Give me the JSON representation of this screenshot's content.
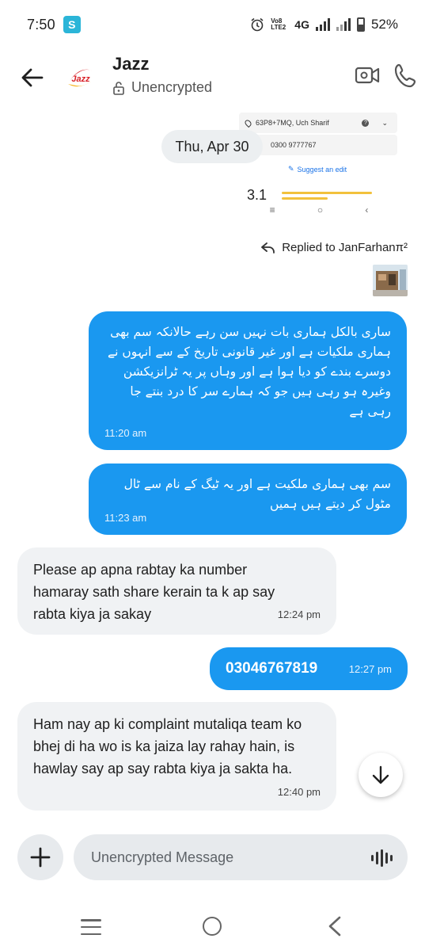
{
  "status_bar": {
    "time": "7:50",
    "network": "4G",
    "volte": "Vo8 LTE2",
    "battery": "52%"
  },
  "header": {
    "contact_name": "Jazz",
    "encryption_status": "Unencrypted",
    "avatar_text": "Jazz"
  },
  "preview": {
    "location": "63P8+7MQ, Uch Sharif",
    "phone": "0300 9777767",
    "suggest": "Suggest an edit",
    "rating": "3.1"
  },
  "date_separator": "Thu, Apr 30",
  "reply_label": "Replied to JanFarhanπ²",
  "messages": [
    {
      "text": "ساری بالکل ہماری بات نہیں سن رہے حالانکہ سم بھی ہماری ملکیات ہے اور غیر قانونی تاریخ کے سے انہوں نے دوسرے بندے کو دیا ہوا ہے اور وہاں پر یہ ٹرانزیکشن وغیرہ ہو رہی ہیں جو کہ ہمارے سر کا درد بنتے جا رہی ہے",
      "time": "11:20 am"
    },
    {
      "text": "سم بھی ہماری ملکیت ہے اور یہ ٹیگ کے نام سے ٹال مٹول کر دیتے ہیں ہمیں",
      "time": "11:23 am"
    },
    {
      "text": "Please ap apna rabtay ka number hamaray sath share kerain ta k ap say rabta kiya ja sakay",
      "time": "12:24 pm"
    },
    {
      "text": "03046767819",
      "time": "12:27 pm"
    },
    {
      "text": "Ham nay ap ki complaint mutaliqa team ko bhej di ha wo is ka jaiza lay rahay hain, is hawlay say ap say rabta kiya ja sakta ha.",
      "time": "12:40 pm"
    }
  ],
  "composer": {
    "placeholder": "Unencrypted Message"
  },
  "colors": {
    "outgoing_bubble": "#1a98f0",
    "incoming_bubble": "#f0f2f4",
    "composer_bg": "#e7eaed"
  }
}
